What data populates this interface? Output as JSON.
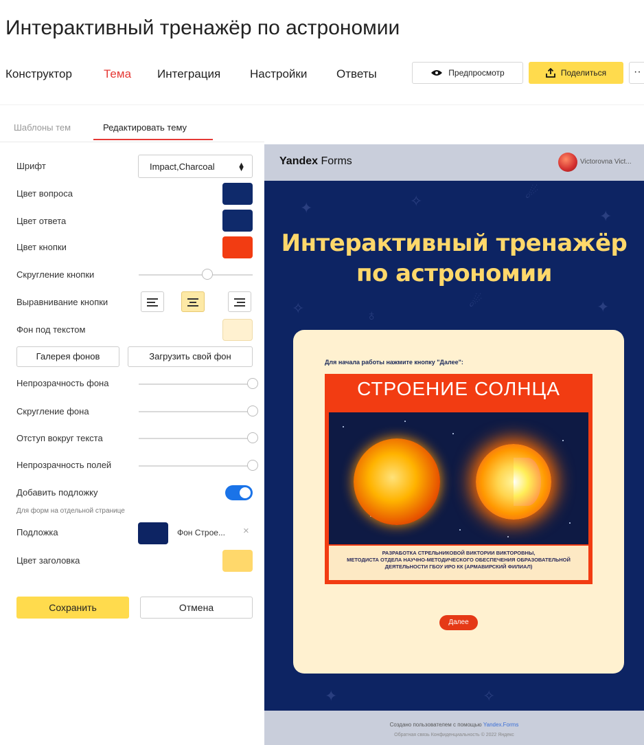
{
  "app": {
    "title": "Интерактивный тренажёр по астрономии"
  },
  "topnav": {
    "items": [
      "Конструктор",
      "Тема",
      "Интеграция",
      "Настройки",
      "Ответы"
    ],
    "preview_label": "Предпросмотр",
    "share_label": "Поделиться",
    "more_label": "··"
  },
  "subtabs": {
    "templates": "Шаблоны тем",
    "edit": "Редактировать тему"
  },
  "settings": {
    "font_label": "Шрифт",
    "font_value": "Impact,Charcoal",
    "question_color_label": "Цвет вопроса",
    "answer_color_label": "Цвет ответа",
    "button_color_label": "Цвет кнопки",
    "button_rounding_label": "Скругление кнопки",
    "button_align_label": "Выравнивание кнопки",
    "text_bg_label": "Фон под текстом",
    "gallery_button": "Галерея фонов",
    "upload_button": "Загрузить свой фон",
    "bg_opacity_label": "Непрозрачность фона",
    "bg_rounding_label": "Скругление фона",
    "text_padding_label": "Отступ вокруг текста",
    "fields_opacity_label": "Непрозрачность полей",
    "add_backdrop_label": "Добавить подложку",
    "backdrop_hint": "Для форм на отдельной странице",
    "backdrop_label": "Подложка",
    "backdrop_name": "Фон Строе...",
    "header_color_label": "Цвет заголовка",
    "button_rounding_level": 0.6,
    "bg_opacity_level": 1.0,
    "bg_rounding_level": 1.0,
    "text_padding_level": 1.0,
    "fields_opacity_level": 1.0,
    "add_backdrop_on": true,
    "button_align_selected": "center"
  },
  "colors": {
    "question": "#0f2a6b",
    "answer": "#0f2a6b",
    "button": "#f23c12",
    "text_bg": "#fff1d0",
    "backdrop": "#0d2463",
    "header": "#ffd86b",
    "theme_tab": "#e53935"
  },
  "actions": {
    "save": "Сохранить",
    "cancel": "Отмена"
  },
  "preview": {
    "logo_bold": "Yandex",
    "logo_rest": " Forms",
    "user": "Victorovna Vict...",
    "title": "Интерактивный тренажёр по астрономии",
    "note": "Для начала работы нажмите кнопку \"Далее\":",
    "poster_title": "СТРОЕНИЕ СОЛНЦА",
    "poster_credit_1": "РАЗРАБОТКА СТРЕЛЬНИКОВОЙ ВИКТОРИИ ВИКТОРОВНЫ,",
    "poster_credit_2": "МЕТОДИСТА ОТДЕЛА НАУЧНО-МЕТОДИЧЕСКОГО ОБЕСПЕЧЕНИЯ ОБРАЗОВАТЕЛЬНОЙ",
    "poster_credit_3": "ДЕЯТЕЛЬНОСТИ ГБОУ ИРО КК (АРМАВИРСКИЙ ФИЛИАЛ)",
    "next_button": "Далее",
    "footer_text": "Создано пользователем с помощью ",
    "footer_link": "Yandex.Forms",
    "footer_links": "Обратная связь   Конфиденциальность   © 2022 Яндекс"
  },
  "icons": {
    "preview": "eye-icon",
    "share": "share-upload-icon",
    "clear": "close-icon",
    "select": "sort-arrows-icon"
  }
}
